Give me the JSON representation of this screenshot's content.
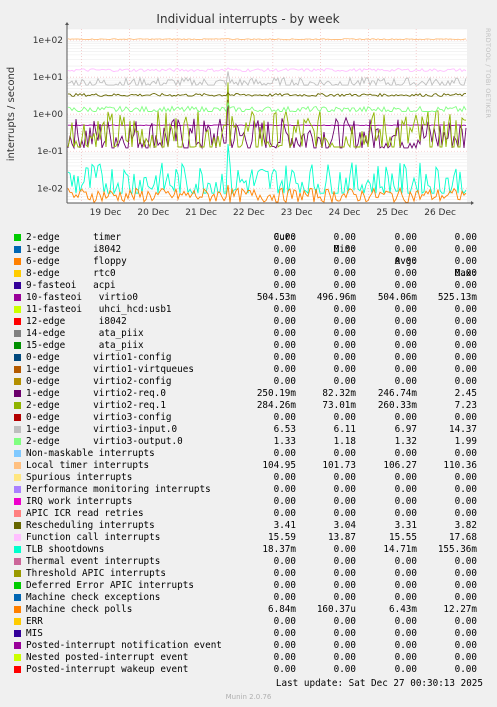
{
  "chart_data": {
    "type": "line",
    "title": "Individual interrupts - by week",
    "ylabel": "interrupts / second",
    "yscale": "log",
    "ylim": [
      0.004,
      200
    ],
    "yticks": [
      "1e+02",
      "1e+01",
      "1e+00",
      "1e-01",
      "1e-02"
    ],
    "x": [
      "19 Dec",
      "20 Dec",
      "21 Dec",
      "22 Dec",
      "23 Dec",
      "24 Dec",
      "25 Dec",
      "26 Dec"
    ],
    "grid": true,
    "columns": [
      "Cur:",
      "Min:",
      "Avg:",
      "Max:"
    ],
    "series": [
      {
        "name": "2-edge      timer",
        "color": "#00cc00",
        "cur": "0.00",
        "min": "0.00",
        "avg": "0.00",
        "max": "0.00"
      },
      {
        "name": "1-edge      i8042",
        "color": "#0066b3",
        "cur": "0.00",
        "min": "0.00",
        "avg": "0.00",
        "max": "0.00"
      },
      {
        "name": "6-edge      floppy",
        "color": "#ff8000",
        "cur": "0.00",
        "min": "0.00",
        "avg": "0.00",
        "max": "0.00"
      },
      {
        "name": "8-edge      rtc0",
        "color": "#ffcc00",
        "cur": "0.00",
        "min": "0.00",
        "avg": "0.00",
        "max": "0.00"
      },
      {
        "name": "9-fasteoi   acpi",
        "color": "#330099",
        "cur": "0.00",
        "min": "0.00",
        "avg": "0.00",
        "max": "0.00"
      },
      {
        "name": "10-fasteoi   virtio0",
        "color": "#990099",
        "cur": "504.53m",
        "min": "496.96m",
        "avg": "504.06m",
        "max": "525.13m"
      },
      {
        "name": "11-fasteoi   uhci_hcd:usb1",
        "color": "#ccff00",
        "cur": "0.00",
        "min": "0.00",
        "avg": "0.00",
        "max": "0.00"
      },
      {
        "name": "12-edge      i8042",
        "color": "#ff0000",
        "cur": "0.00",
        "min": "0.00",
        "avg": "0.00",
        "max": "0.00"
      },
      {
        "name": "14-edge      ata_piix",
        "color": "#808080",
        "cur": "0.00",
        "min": "0.00",
        "avg": "0.00",
        "max": "0.00"
      },
      {
        "name": "15-edge      ata_piix",
        "color": "#008f00",
        "cur": "0.00",
        "min": "0.00",
        "avg": "0.00",
        "max": "0.00"
      },
      {
        "name": "0-edge      virtio1-config",
        "color": "#00487d",
        "cur": "0.00",
        "min": "0.00",
        "avg": "0.00",
        "max": "0.00"
      },
      {
        "name": "1-edge      virtio1-virtqueues",
        "color": "#b35a00",
        "cur": "0.00",
        "min": "0.00",
        "avg": "0.00",
        "max": "0.00"
      },
      {
        "name": "0-edge      virtio2-config",
        "color": "#b38f00",
        "cur": "0.00",
        "min": "0.00",
        "avg": "0.00",
        "max": "0.00"
      },
      {
        "name": "1-edge      virtio2-req.0",
        "color": "#6b006b",
        "cur": "250.19m",
        "min": "82.32m",
        "avg": "246.74m",
        "max": "2.45"
      },
      {
        "name": "2-edge      virtio2-req.1",
        "color": "#8fb300",
        "cur": "284.26m",
        "min": "73.01m",
        "avg": "260.33m",
        "max": "7.23"
      },
      {
        "name": "0-edge      virtio3-config",
        "color": "#b30000",
        "cur": "0.00",
        "min": "0.00",
        "avg": "0.00",
        "max": "0.00"
      },
      {
        "name": "1-edge      virtio3-input.0",
        "color": "#bebebe",
        "cur": "6.53",
        "min": "6.11",
        "avg": "6.97",
        "max": "14.37"
      },
      {
        "name": "2-edge      virtio3-output.0",
        "color": "#80ff80",
        "cur": "1.33",
        "min": "1.18",
        "avg": "1.32",
        "max": "1.99"
      },
      {
        "name": "Non-maskable interrupts",
        "color": "#80c9ff",
        "cur": "0.00",
        "min": "0.00",
        "avg": "0.00",
        "max": "0.00"
      },
      {
        "name": "Local timer interrupts",
        "color": "#ffc080",
        "cur": "104.95",
        "min": "101.73",
        "avg": "106.27",
        "max": "110.36"
      },
      {
        "name": "Spurious interrupts",
        "color": "#ffe680",
        "cur": "0.00",
        "min": "0.00",
        "avg": "0.00",
        "max": "0.00"
      },
      {
        "name": "Performance monitoring interrupts",
        "color": "#aa80ff",
        "cur": "0.00",
        "min": "0.00",
        "avg": "0.00",
        "max": "0.00"
      },
      {
        "name": "IRQ work interrupts",
        "color": "#ee00cc",
        "cur": "0.00",
        "min": "0.00",
        "avg": "0.00",
        "max": "0.00"
      },
      {
        "name": "APIC ICR read retries",
        "color": "#ff8080",
        "cur": "0.00",
        "min": "0.00",
        "avg": "0.00",
        "max": "0.00"
      },
      {
        "name": "Rescheduling interrupts",
        "color": "#666600",
        "cur": "3.41",
        "min": "3.04",
        "avg": "3.31",
        "max": "3.82"
      },
      {
        "name": "Function call interrupts",
        "color": "#ffbfff",
        "cur": "15.59",
        "min": "13.87",
        "avg": "15.55",
        "max": "17.68"
      },
      {
        "name": "TLB shootdowns",
        "color": "#00ffcc",
        "cur": "18.37m",
        "min": "0.00",
        "avg": "14.71m",
        "max": "155.36m"
      },
      {
        "name": "Thermal event interrupts",
        "color": "#cc6699",
        "cur": "0.00",
        "min": "0.00",
        "avg": "0.00",
        "max": "0.00"
      },
      {
        "name": "Threshold APIC interrupts",
        "color": "#999900",
        "cur": "0.00",
        "min": "0.00",
        "avg": "0.00",
        "max": "0.00"
      },
      {
        "name": "Deferred Error APIC interrupts",
        "color": "#00cc00",
        "cur": "0.00",
        "min": "0.00",
        "avg": "0.00",
        "max": "0.00"
      },
      {
        "name": "Machine check exceptions",
        "color": "#0066b3",
        "cur": "0.00",
        "min": "0.00",
        "avg": "0.00",
        "max": "0.00"
      },
      {
        "name": "Machine check polls",
        "color": "#ff8000",
        "cur": "6.84m",
        "min": "160.37u",
        "avg": "6.43m",
        "max": "12.27m"
      },
      {
        "name": "ERR",
        "color": "#ffcc00",
        "cur": "0.00",
        "min": "0.00",
        "avg": "0.00",
        "max": "0.00"
      },
      {
        "name": "MIS",
        "color": "#330099",
        "cur": "0.00",
        "min": "0.00",
        "avg": "0.00",
        "max": "0.00"
      },
      {
        "name": "Posted-interrupt notification event",
        "color": "#990099",
        "cur": "0.00",
        "min": "0.00",
        "avg": "0.00",
        "max": "0.00"
      },
      {
        "name": "Nested posted-interrupt event",
        "color": "#ccff00",
        "cur": "0.00",
        "min": "0.00",
        "avg": "0.00",
        "max": "0.00"
      },
      {
        "name": "Posted-interrupt wakeup event",
        "color": "#ff0000",
        "cur": "0.00",
        "min": "0.00",
        "avg": "0.00",
        "max": "0.00"
      }
    ]
  },
  "last_update": "Last update: Sat Dec 27 00:30:13 2025",
  "footer": "Munin 2.0.76",
  "side_label": "RRDTOOL / TOBI OETIKER"
}
